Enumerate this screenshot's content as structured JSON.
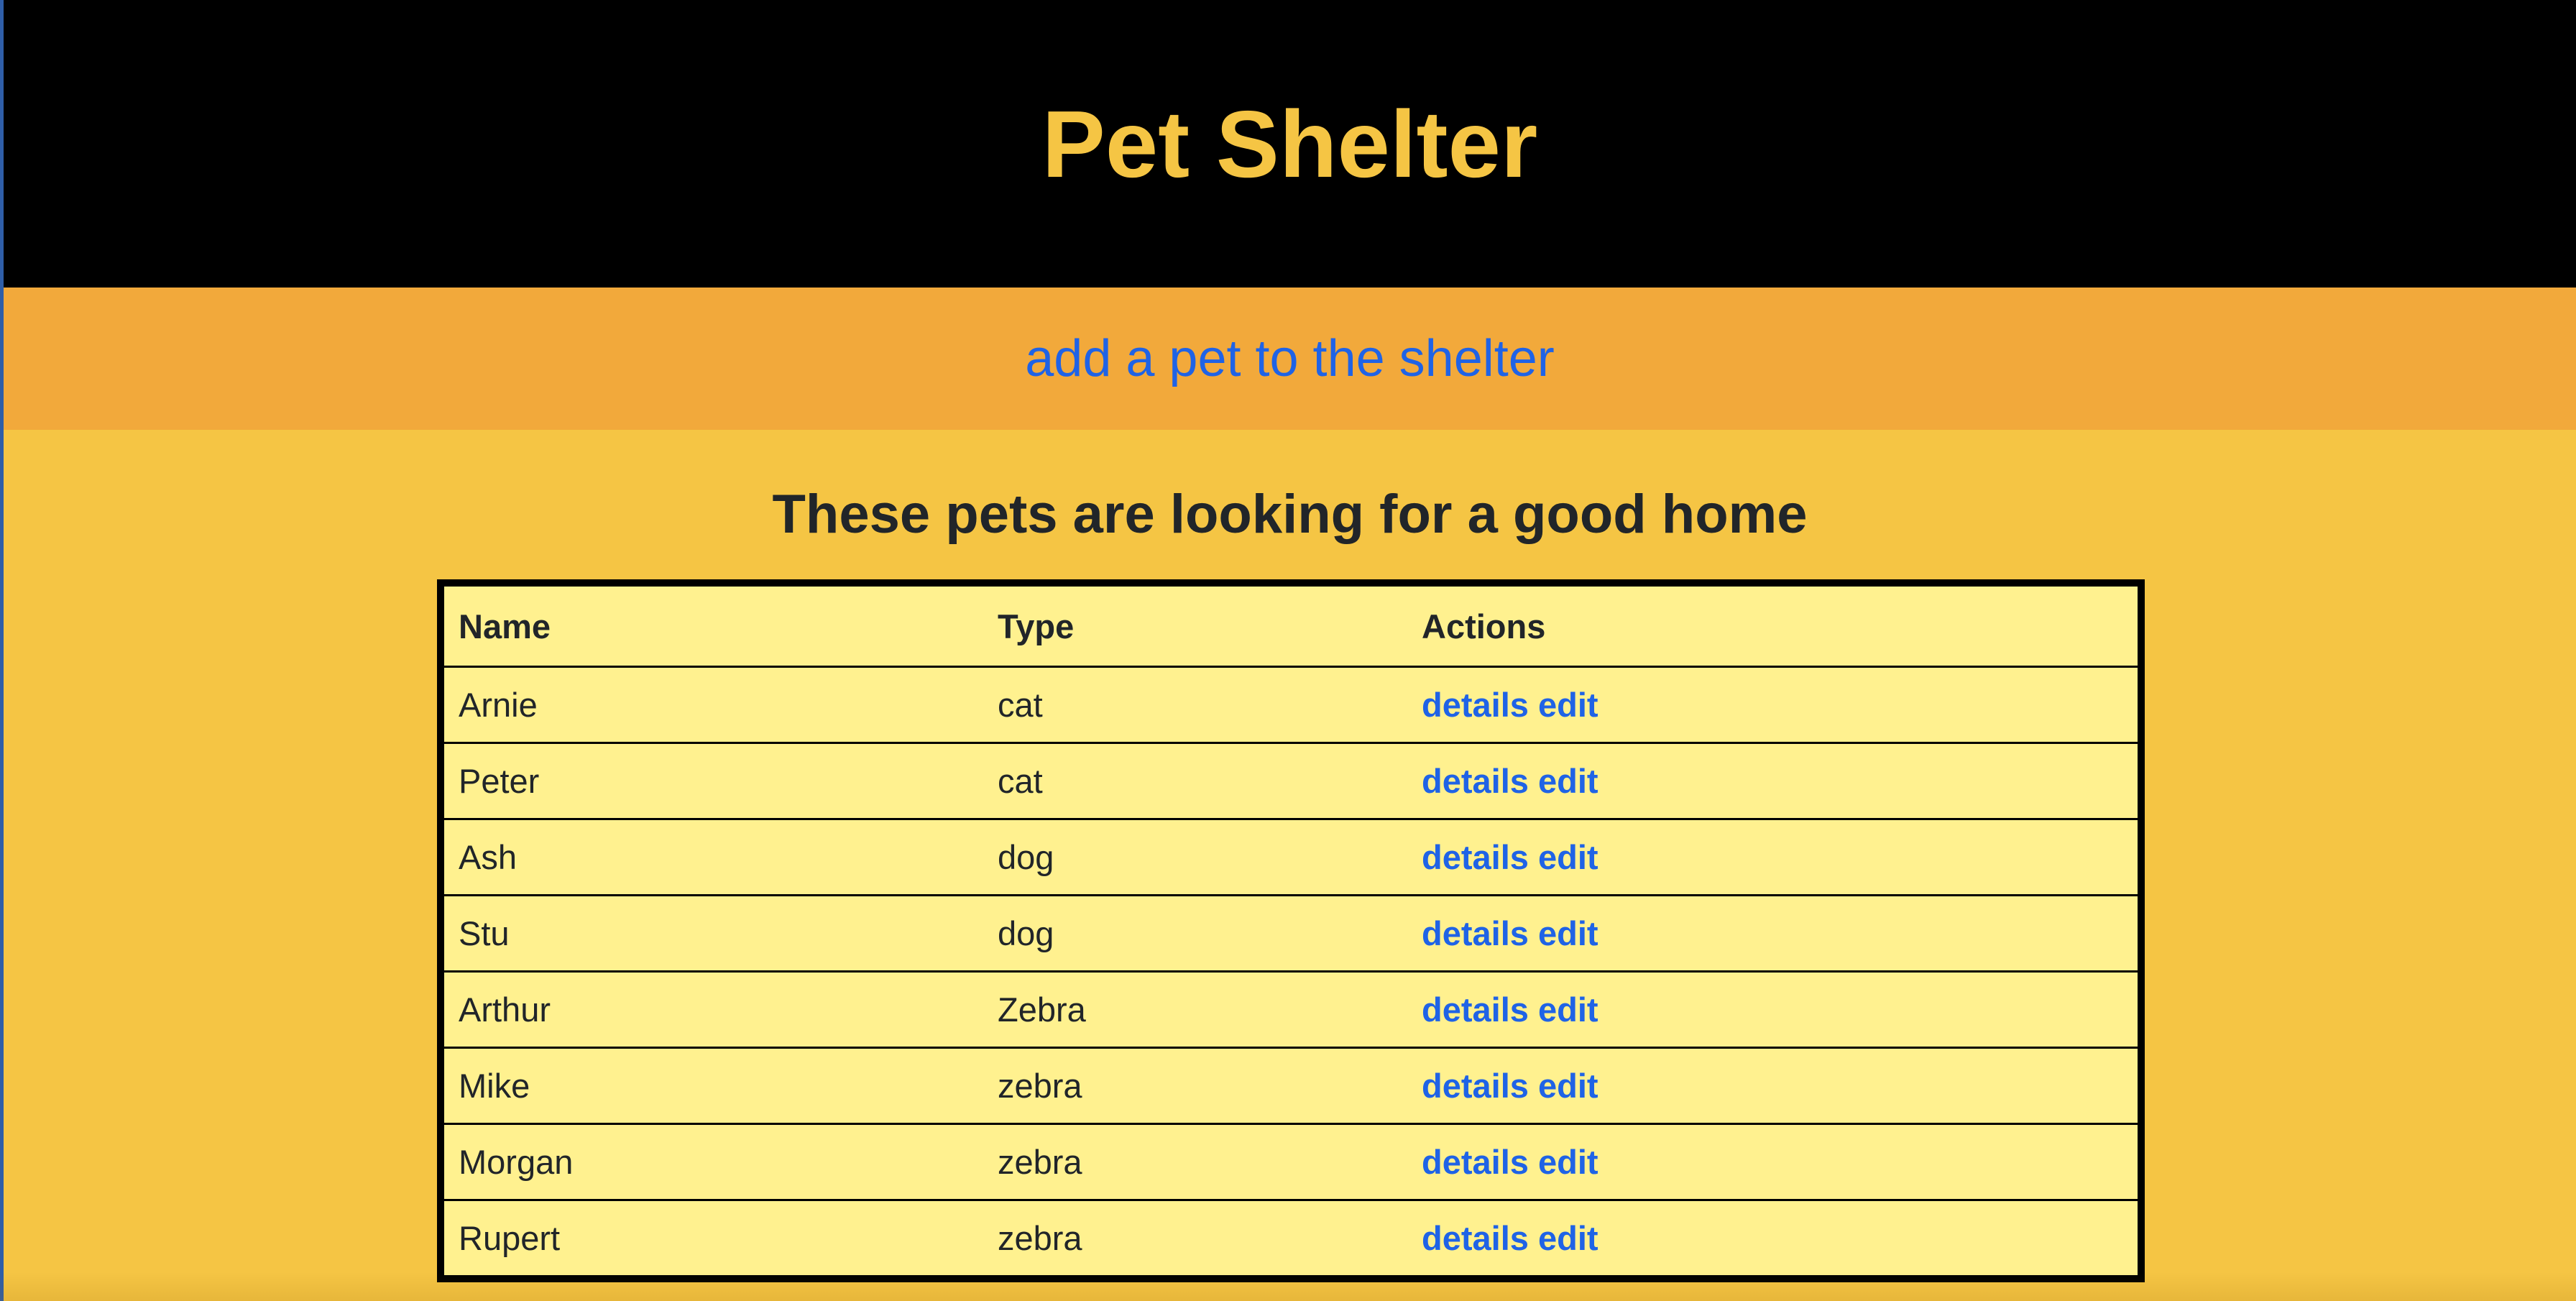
{
  "header": {
    "title": "Pet Shelter"
  },
  "nav": {
    "add_link": "add a pet to the shelter"
  },
  "main": {
    "heading": "These pets are looking for a good home",
    "table": {
      "columns": [
        "Name",
        "Type",
        "Actions"
      ],
      "rows": [
        {
          "name": "Arnie",
          "type": "cat",
          "details": "details",
          "edit": "edit"
        },
        {
          "name": "Peter",
          "type": "cat",
          "details": "details",
          "edit": "edit"
        },
        {
          "name": "Ash",
          "type": "dog",
          "details": "details",
          "edit": "edit"
        },
        {
          "name": "Stu",
          "type": "dog",
          "details": "details",
          "edit": "edit"
        },
        {
          "name": "Arthur",
          "type": "Zebra",
          "details": "details",
          "edit": "edit"
        },
        {
          "name": "Mike",
          "type": "zebra",
          "details": "details",
          "edit": "edit"
        },
        {
          "name": "Morgan",
          "type": "zebra",
          "details": "details",
          "edit": "edit"
        },
        {
          "name": "Rupert",
          "type": "zebra",
          "details": "details",
          "edit": "edit"
        }
      ]
    }
  },
  "colors": {
    "header_bg": "#000000",
    "accent": "#f5c544",
    "nav_bg": "#f2a93b",
    "link": "#1f63e6",
    "table_bg": "#fff18f"
  }
}
